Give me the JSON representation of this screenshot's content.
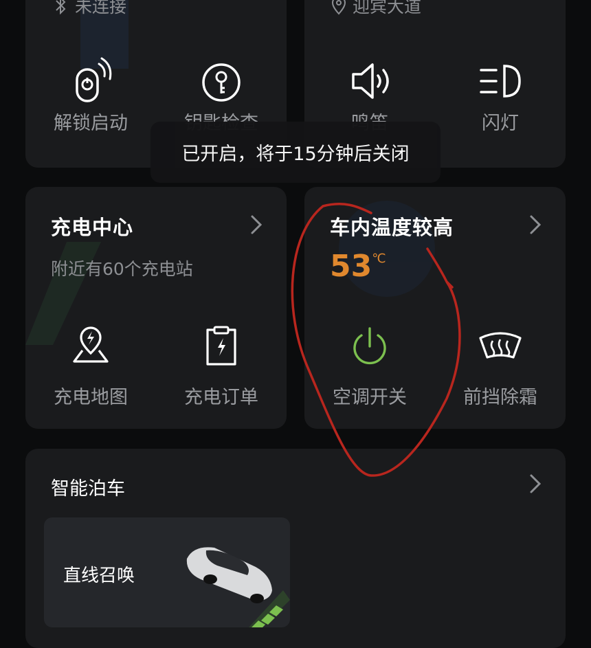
{
  "toast": {
    "text": "已开启，将于15分钟后关闭"
  },
  "top_left_card": {
    "status": "未连接",
    "actions": [
      {
        "label": "解锁启动",
        "icon": "remote-key-icon"
      },
      {
        "label": "钥匙检查",
        "icon": "key-icon"
      }
    ]
  },
  "top_right_card": {
    "location": "迎宾大道",
    "actions": [
      {
        "label": "鸣笛",
        "icon": "horn-icon"
      },
      {
        "label": "闪灯",
        "icon": "headlight-icon"
      }
    ]
  },
  "charging_card": {
    "title": "充电中心",
    "subtitle": "附近有60个充电站",
    "actions": [
      {
        "label": "充电地图",
        "icon": "charging-map-icon"
      },
      {
        "label": "充电订单",
        "icon": "charging-order-icon"
      }
    ]
  },
  "climate_card": {
    "title": "车内温度较高",
    "temperature": "53",
    "unit": "℃",
    "actions": [
      {
        "label": "空调开关",
        "icon": "power-icon"
      },
      {
        "label": "前挡除霜",
        "icon": "defrost-icon"
      }
    ]
  },
  "parking_card": {
    "title": "智能泊车",
    "feature": {
      "label": "直线召唤"
    }
  },
  "colors": {
    "background": "#0b0c0d",
    "card": "#1a1b1d",
    "temperature": "#e0882e",
    "power_on": "#7cc04f",
    "annotation": "#b8261e"
  }
}
